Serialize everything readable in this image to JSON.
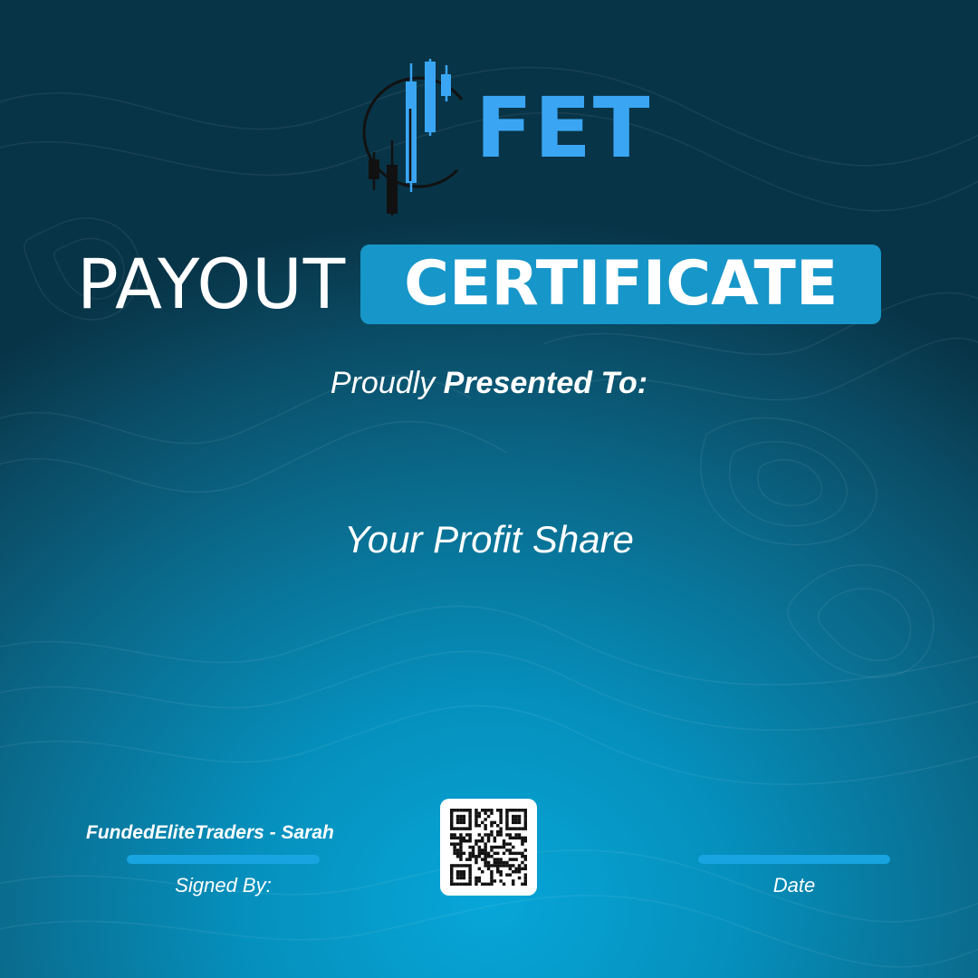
{
  "logo": {
    "text": "FET",
    "color": "#3aa6f3"
  },
  "headline": {
    "light": "PAYOUT",
    "bold": "CERTIFICATE"
  },
  "presented": {
    "normal": "Proudly",
    "bold": "Presented To:"
  },
  "recipient": "Your Profit Share",
  "signature": {
    "name": "FundedEliteTraders - Sarah",
    "caption": "Signed By:"
  },
  "date": {
    "caption": "Date"
  },
  "colors": {
    "accent": "#1796c9",
    "line": "#17a4e0",
    "background_dark": "#083447",
    "background_light": "#07a6d8"
  }
}
